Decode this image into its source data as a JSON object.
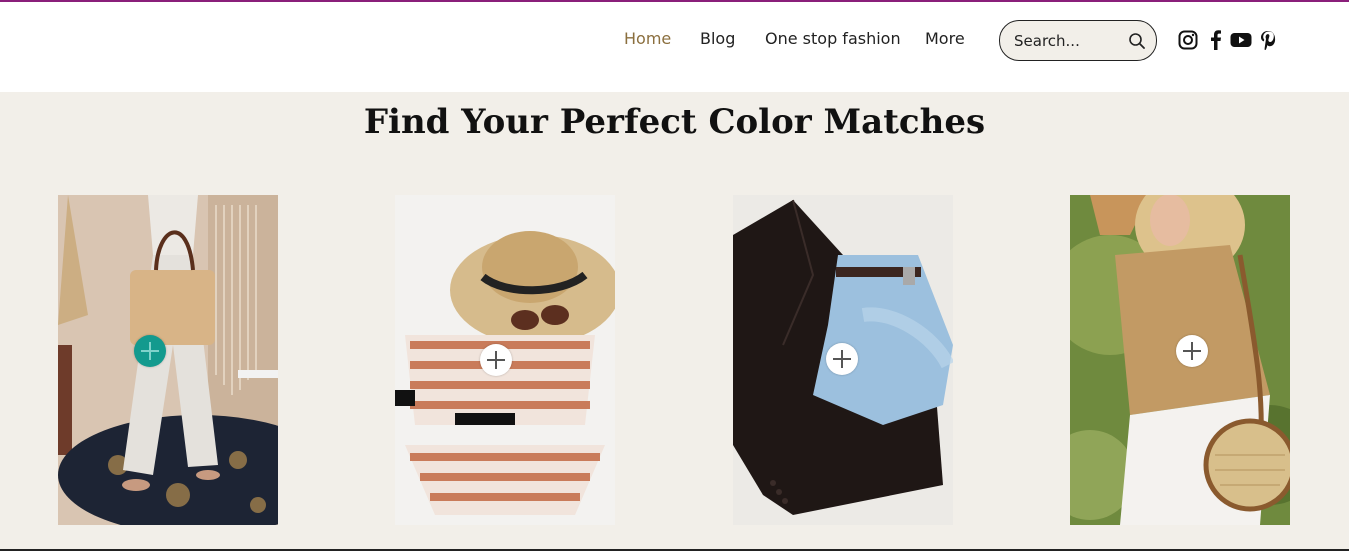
{
  "nav": {
    "items": [
      {
        "label": "Home",
        "active": true
      },
      {
        "label": "Blog",
        "active": false
      },
      {
        "label": "One stop fashion",
        "active": false
      },
      {
        "label": "More",
        "active": false
      }
    ]
  },
  "search": {
    "placeholder": "Search..."
  },
  "social": [
    "instagram-icon",
    "facebook-icon",
    "youtube-icon",
    "pinterest-icon"
  ],
  "heading": "Find Your Perfect Color Matches",
  "colors": {
    "accent": "#8b6f3e",
    "background": "#f2efe9",
    "topline": "#8a1f7a",
    "hotspot_active": "#139a8e"
  },
  "gallery": [
    {
      "name": "woman-with-tote-bag-photo",
      "hotspot_active": true
    },
    {
      "name": "straw-hat-and-striped-bikini-photo",
      "hotspot_active": false
    },
    {
      "name": "black-blazer-and-jeans-photo",
      "hotspot_active": false
    },
    {
      "name": "woman-in-tan-shirt-with-round-bag-photo",
      "hotspot_active": false
    }
  ]
}
